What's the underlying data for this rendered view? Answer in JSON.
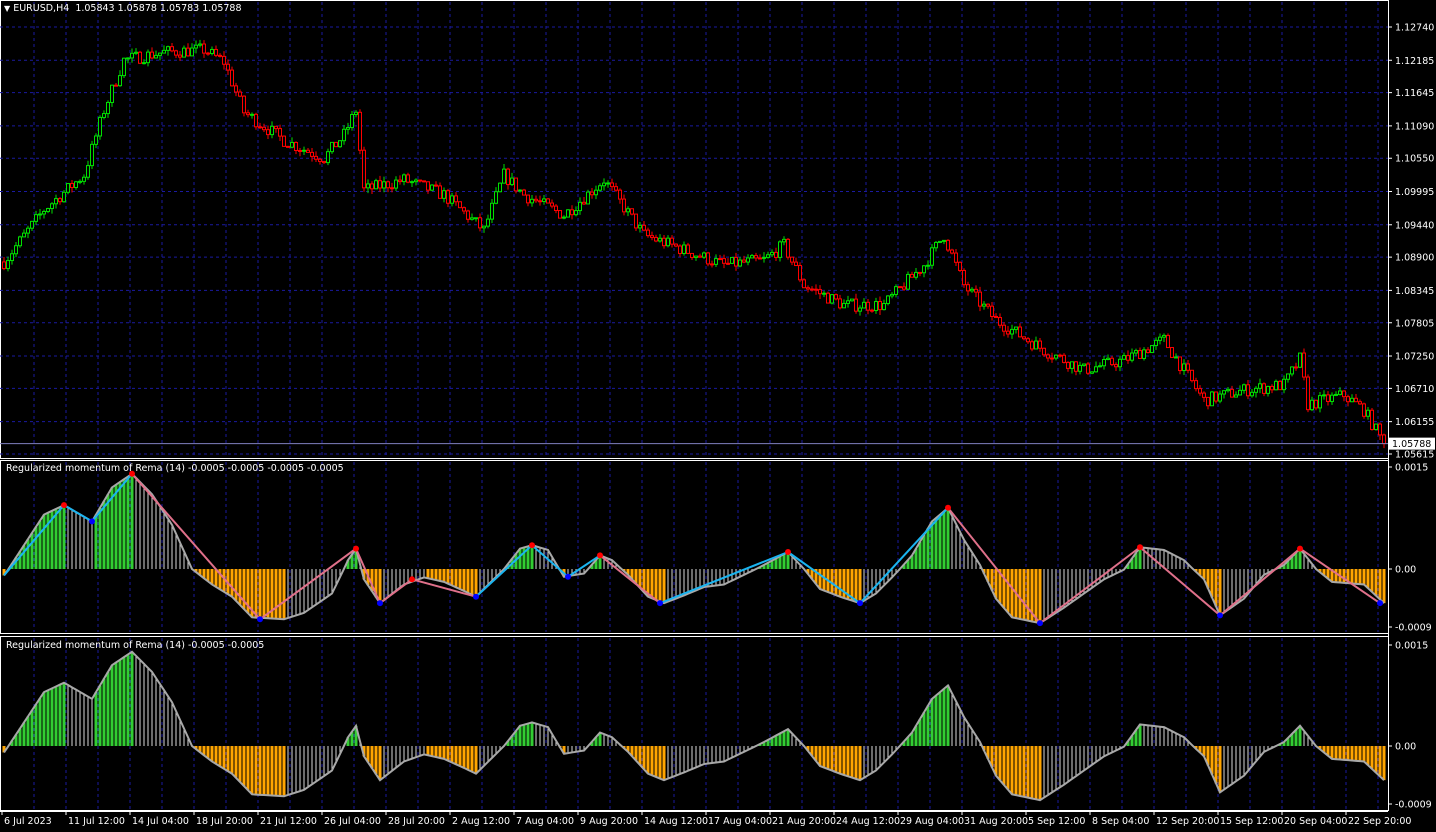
{
  "header": {
    "symbol": "EURUSD,H4",
    "ohlc": "1.05843 1.05878 1.05783 1.05788",
    "menu_icon": "triangle-down-icon"
  },
  "colors": {
    "bull": "#00e000",
    "bear": "#ff0000",
    "grid": "#1a1aa0",
    "axis": "#ffffff",
    "hist_up": "#32cd32",
    "hist_down": "#ffa500",
    "hist_neutral": "#d8d8d8",
    "momentum_line": "#a8a8a8",
    "zig_up": "#1ab4f0",
    "zig_down": "#e0708a",
    "peak": "#ff0000",
    "trough": "#0000ff"
  },
  "price_axis": {
    "ticks": [
      "1.12740",
      "1.12185",
      "1.11645",
      "1.11090",
      "1.10550",
      "1.09995",
      "1.09440",
      "1.08900",
      "1.08345",
      "1.07805",
      "1.07250",
      "1.06710",
      "1.06155",
      "1.05615"
    ],
    "current": "1.05788"
  },
  "time_axis": {
    "ticks": [
      "6 Jul 2023",
      "11 Jul 12:00",
      "14 Jul 04:00",
      "18 Jul 20:00",
      "21 Jul 12:00",
      "26 Jul 04:00",
      "28 Jul 20:00",
      "2 Aug 12:00",
      "7 Aug 04:00",
      "9 Aug 20:00",
      "14 Aug 12:00",
      "17 Aug 04:00",
      "21 Aug 20:00",
      "24 Aug 12:00",
      "29 Aug 04:00",
      "31 Aug 20:00",
      "5 Sep 12:00",
      "8 Sep 04:00",
      "12 Sep 20:00",
      "15 Sep 12:00",
      "20 Sep 04:00",
      "22 Sep 20:00"
    ]
  },
  "indicator1": {
    "title": "Regularized momentum of Rema (14) -0.0005 -0.0005 -0.0005 -0.0005",
    "ticks": [
      "0.0015",
      "0.00",
      "-0.0009"
    ]
  },
  "indicator2": {
    "title": "Regularized momentum of Rema (14) -0.0005 -0.0005",
    "ticks": [
      "0.0015",
      "0.00",
      "-0.0009"
    ]
  },
  "chart_data": {
    "type": "candlestick",
    "timeframe": "H4",
    "ylim": [
      1.05615,
      1.1274
    ],
    "price_path": [
      [
        0,
        1.0882
      ],
      [
        10,
        1.0969
      ],
      [
        20,
        1.1027
      ],
      [
        25,
        1.1135
      ],
      [
        30,
        1.1219
      ],
      [
        40,
        1.1232
      ],
      [
        50,
        1.1236
      ],
      [
        55,
        1.1216
      ],
      [
        60,
        1.1132
      ],
      [
        70,
        1.1085
      ],
      [
        80,
        1.1055
      ],
      [
        85,
        1.1094
      ],
      [
        88,
        1.1135
      ],
      [
        90,
        1.1002
      ],
      [
        100,
        1.1019
      ],
      [
        110,
        1.0994
      ],
      [
        120,
        1.0935
      ],
      [
        125,
        1.1027
      ],
      [
        130,
        1.0994
      ],
      [
        140,
        1.096
      ],
      [
        150,
        1.1019
      ],
      [
        160,
        1.0927
      ],
      [
        170,
        1.0902
      ],
      [
        180,
        1.0877
      ],
      [
        190,
        1.0885
      ],
      [
        195,
        1.091
      ],
      [
        200,
        1.0843
      ],
      [
        210,
        1.081
      ],
      [
        220,
        1.081
      ],
      [
        230,
        1.0877
      ],
      [
        235,
        1.0927
      ],
      [
        240,
        1.0843
      ],
      [
        248,
        1.0785
      ],
      [
        260,
        1.0735
      ],
      [
        270,
        1.0702
      ],
      [
        280,
        1.0718
      ],
      [
        290,
        1.0752
      ],
      [
        300,
        1.0651
      ],
      [
        310,
        1.0668
      ],
      [
        320,
        1.0677
      ],
      [
        324,
        1.072
      ],
      [
        326,
        1.0644
      ],
      [
        335,
        1.066
      ],
      [
        340,
        1.0635
      ],
      [
        345,
        1.0579
      ]
    ],
    "momentum": {
      "ylim": [
        -0.0009,
        0.0015
      ],
      "points": [
        [
          0,
          -0.0001
        ],
        [
          5,
          0.00035
        ],
        [
          10,
          0.0008
        ],
        [
          15,
          0.00094
        ],
        [
          22,
          0.0007
        ],
        [
          27,
          0.0012
        ],
        [
          32,
          0.0014
        ],
        [
          37,
          0.0011
        ],
        [
          42,
          0.00065
        ],
        [
          47,
          0.0
        ],
        [
          52,
          -0.00024
        ],
        [
          57,
          -0.00043
        ],
        [
          62,
          -0.00075
        ],
        [
          70,
          -0.00078
        ],
        [
          75,
          -0.00068
        ],
        [
          82,
          -0.00038
        ],
        [
          86,
          0.00013
        ],
        [
          88,
          0.0003
        ],
        [
          90,
          -0.00016
        ],
        [
          94,
          -0.00053
        ],
        [
          100,
          -0.00024
        ],
        [
          105,
          -0.00013
        ],
        [
          110,
          -0.0002
        ],
        [
          115,
          -0.00034
        ],
        [
          118,
          -0.00043
        ],
        [
          125,
          0.0
        ],
        [
          129,
          0.0003
        ],
        [
          132,
          0.00035
        ],
        [
          136,
          0.00028
        ],
        [
          140,
          -0.00012
        ],
        [
          145,
          -7e-05
        ],
        [
          149,
          0.0002
        ],
        [
          152,
          0.00013
        ],
        [
          156,
          -9e-05
        ],
        [
          161,
          -0.00043
        ],
        [
          165,
          -0.00053
        ],
        [
          170,
          -0.00041
        ],
        [
          175,
          -0.00028
        ],
        [
          180,
          -0.00024
        ],
        [
          185,
          -9e-05
        ],
        [
          190,
          6e-05
        ],
        [
          196,
          0.00025
        ],
        [
          200,
          0.0
        ],
        [
          204,
          -0.00031
        ],
        [
          209,
          -0.00043
        ],
        [
          214,
          -0.00053
        ],
        [
          218,
          -0.00038
        ],
        [
          222,
          -0.00013
        ],
        [
          227,
          0.0002
        ],
        [
          232,
          0.0007
        ],
        [
          236,
          0.0009
        ],
        [
          240,
          0.00043
        ],
        [
          244,
          6e-05
        ],
        [
          248,
          -0.00046
        ],
        [
          252,
          -0.00075
        ],
        [
          259,
          -0.00084
        ],
        [
          265,
          -0.0006
        ],
        [
          270,
          -0.00038
        ],
        [
          275,
          -0.00016
        ],
        [
          280,
          -1e-05
        ],
        [
          284,
          0.00032
        ],
        [
          290,
          0.00028
        ],
        [
          295,
          0.00013
        ],
        [
          300,
          -0.00016
        ],
        [
          304,
          -0.00072
        ],
        [
          310,
          -0.00046
        ],
        [
          315,
          -9e-05
        ],
        [
          320,
          6e-05
        ],
        [
          324,
          0.0003
        ],
        [
          328,
          0.0
        ],
        [
          332,
          -0.0002
        ],
        [
          340,
          -0.00024
        ],
        [
          345,
          -0.00053
        ]
      ],
      "zigzag": [
        [
          0,
          -0.0001,
          "up"
        ],
        [
          15,
          0.00094,
          "up"
        ],
        [
          22,
          0.0007,
          "up"
        ],
        [
          32,
          0.0014,
          "down"
        ],
        [
          64,
          -0.00078,
          "down"
        ],
        [
          88,
          0.0003,
          "down"
        ],
        [
          94,
          -0.00053,
          "down"
        ],
        [
          102,
          -0.00016,
          "down"
        ],
        [
          118,
          -0.00043,
          "up"
        ],
        [
          132,
          0.00035,
          "up"
        ],
        [
          141,
          -0.00012,
          "up"
        ],
        [
          149,
          0.0002,
          "down"
        ],
        [
          164,
          -0.00053,
          "up"
        ],
        [
          196,
          0.00025,
          "up"
        ],
        [
          214,
          -0.00053,
          "up"
        ],
        [
          236,
          0.0009,
          "down"
        ],
        [
          259,
          -0.00084,
          "down"
        ],
        [
          284,
          0.00032,
          "down"
        ],
        [
          304,
          -0.00072,
          "down"
        ],
        [
          324,
          0.0003,
          "down"
        ],
        [
          344,
          -0.00053,
          "down"
        ]
      ]
    }
  }
}
